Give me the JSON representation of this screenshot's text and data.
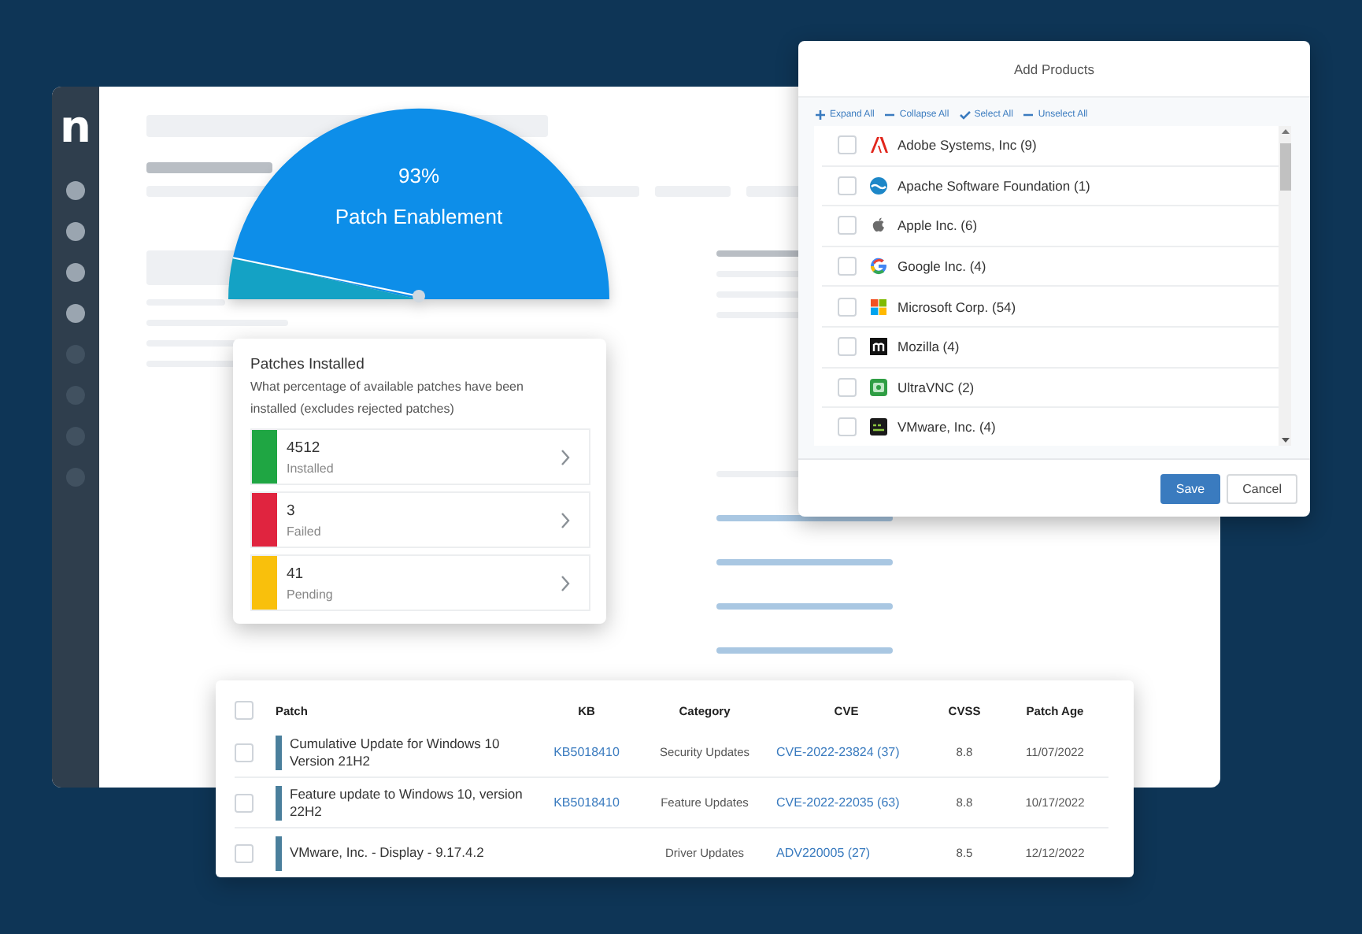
{
  "logo": "n",
  "gauge": {
    "value": "93%",
    "label": "Patch Enablement"
  },
  "patches_card": {
    "title": "Patches Installed",
    "description": "What percentage of available patches have been installed (excludes rejected patches)",
    "items": [
      {
        "count": "4512",
        "label": "Installed",
        "color": "#1fa643"
      },
      {
        "count": "3",
        "label": "Failed",
        "color": "#e0243f"
      },
      {
        "count": "41",
        "label": "Pending",
        "color": "#f9c00c"
      }
    ]
  },
  "dialog": {
    "title": "Add Products",
    "actions": [
      {
        "label": "Expand All",
        "kind": "expand"
      },
      {
        "label": "Collapse All",
        "kind": "collapse"
      },
      {
        "label": "Select All",
        "kind": "select"
      },
      {
        "label": "Unselect All",
        "kind": "unselect"
      }
    ],
    "products": [
      {
        "name": "Adobe Systems, Inc (9)",
        "checked": false
      },
      {
        "name": "Apache Software Foundation (1)",
        "checked": false
      },
      {
        "name": "Apple Inc. (6)",
        "checked": false
      },
      {
        "name": "Google Inc. (4)",
        "checked": false
      },
      {
        "name": "Microsoft Corp. (54)",
        "checked": false
      },
      {
        "name": "Mozilla (4)",
        "checked": false
      },
      {
        "name": "UltraVNC (2)",
        "checked": false
      },
      {
        "name": "VMware, Inc. (4)",
        "checked": false
      }
    ],
    "buttons": [
      {
        "label": "Save",
        "kind": "primary"
      },
      {
        "label": "Cancel",
        "kind": "secondary"
      }
    ]
  },
  "table": {
    "select_all_checked": false,
    "columns": [
      "Patch",
      "KB",
      "Category",
      "CVE",
      "CVSS",
      "Patch Age"
    ],
    "rows": [
      {
        "checked": false,
        "patch": "Cumulative Update for Windows 10 Version 21H2",
        "kb": "KB5018410",
        "category": "Security Updates",
        "cve": "CVE-2022-23824 (37)",
        "cvss": "8.8",
        "patch_age": "11/07/2022"
      },
      {
        "checked": false,
        "patch": "Feature update to Windows 10, version 22H2",
        "kb": "KB5018410",
        "category": "Feature Updates",
        "cve": "CVE-2022-22035 (63)",
        "cvss": "8.8",
        "patch_age": "10/17/2022"
      },
      {
        "checked": false,
        "patch": "VMware, Inc. - Display - 9.17.4.2",
        "category": "Driver Updates",
        "cve": "ADV220005 (27)",
        "cvss": "8.5",
        "patch_age": "12/12/2022"
      }
    ]
  }
}
